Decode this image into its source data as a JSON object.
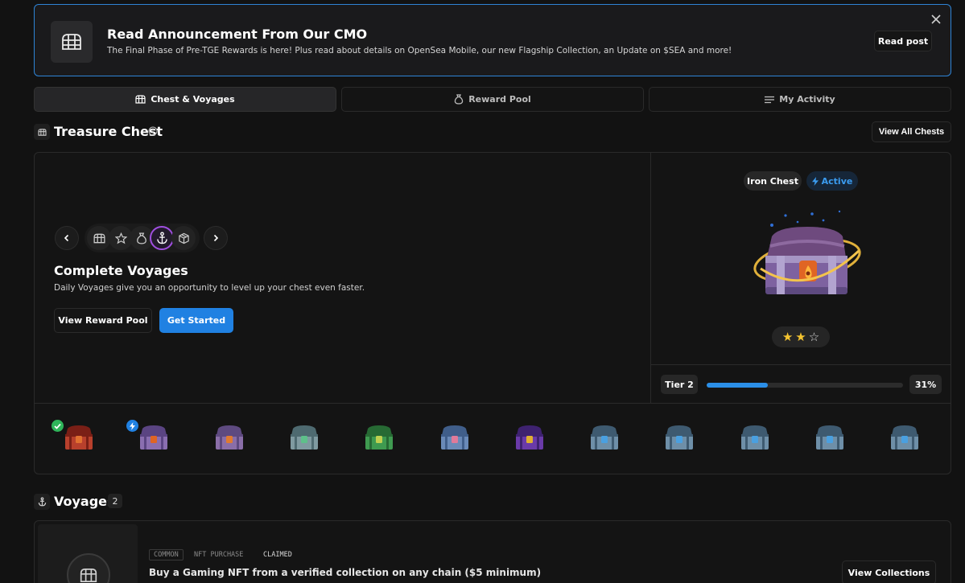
{
  "banner": {
    "title": "Read Announcement From Our CMO",
    "subtitle": "The Final Phase of Pre-TGE Rewards is here! Plus read about details on OpenSea Mobile, our new Flagship Collection, an Update on $SEA and more!",
    "read_label": "Read post",
    "icon": "chest-icon",
    "close_icon": "close-icon"
  },
  "tabs": [
    {
      "label": "Chest & Voyages",
      "icon": "chest-icon",
      "active": true
    },
    {
      "label": "Reward Pool",
      "icon": "money-bag-icon",
      "active": false
    },
    {
      "label": "My Activity",
      "icon": "list-icon",
      "active": false
    }
  ],
  "treasure": {
    "title": "Treasure Chest",
    "view_all_label": "View All Chests",
    "step_icons": [
      "chest-icon",
      "star-icon",
      "money-bag-icon",
      "anchor-icon",
      "box-icon"
    ],
    "active_step": 3,
    "voyage_title": "Complete Voyages",
    "voyage_desc": "Daily Voyages give you an opportunity to level up your chest even faster.",
    "view_reward_label": "View Reward Pool",
    "get_started_label": "Get Started",
    "chest_name": "Iron Chest",
    "status": "Active",
    "stars_filled": 2,
    "stars_total": 3,
    "tier_label": "Tier 2",
    "progress": 0.31,
    "progress_label": "31%",
    "chest_count": 12,
    "chest_states": [
      "completed",
      "active",
      "locked",
      "locked",
      "locked",
      "locked",
      "locked",
      "locked",
      "locked",
      "locked",
      "locked",
      "locked"
    ]
  },
  "voyages": {
    "title": "Voyages",
    "count": "2",
    "item": {
      "tags": [
        "COMMON",
        "NFT PURCHASE",
        "CLAIMED"
      ],
      "title": "Buy a Gaming NFT from a verified collection on any chain ($5 minimum)",
      "action_label": "View Collections"
    }
  },
  "colors": {
    "accent_blue": "#2081e2",
    "active_purple": "#a04fe0",
    "success_green": "#2fb55a",
    "star_gold": "#f4c430"
  }
}
